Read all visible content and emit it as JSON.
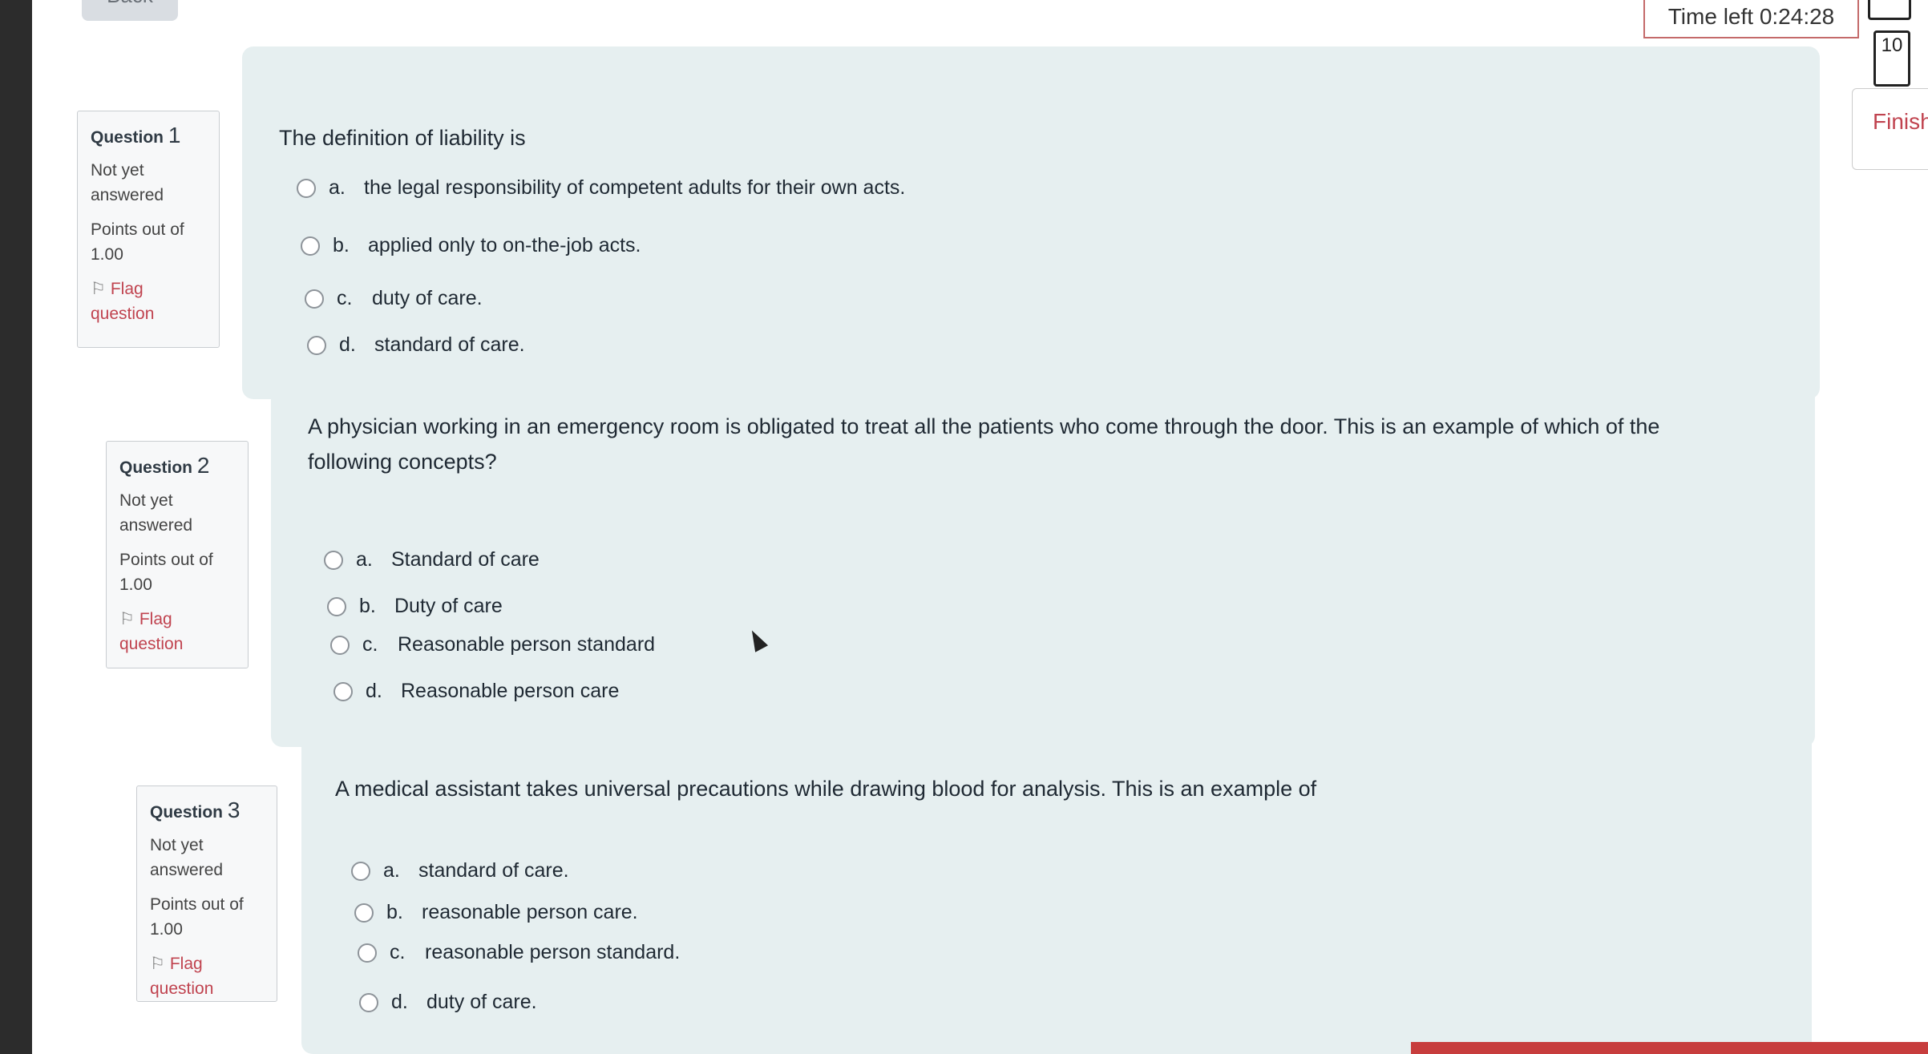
{
  "nav": {
    "back_label": "Back",
    "timer": "Time left 0:24:28",
    "question_box": "10",
    "finish_label": "Finish"
  },
  "questions": [
    {
      "label": "Question",
      "number": "1",
      "state": "Not yet answered",
      "points": "Points out of 1.00",
      "flag": "Flag question",
      "text": "The definition of liability is",
      "options": [
        {
          "letter": "a.",
          "text": "the legal responsibility of competent adults for their own acts."
        },
        {
          "letter": "b.",
          "text": "applied only to on-the-job acts."
        },
        {
          "letter": "c.",
          "text": "duty of care."
        },
        {
          "letter": "d.",
          "text": "standard of care."
        }
      ]
    },
    {
      "label": "Question",
      "number": "2",
      "state": "Not yet answered",
      "points": "Points out of 1.00",
      "flag": "Flag question",
      "text": "A physician working in an emergency room is obligated to treat all the patients who come through the door. This is an example of which of the following concepts?",
      "options": [
        {
          "letter": "a.",
          "text": "Standard of care"
        },
        {
          "letter": "b.",
          "text": "Duty of care"
        },
        {
          "letter": "c.",
          "text": "Reasonable person standard"
        },
        {
          "letter": "d.",
          "text": "Reasonable person care"
        }
      ]
    },
    {
      "label": "Question",
      "number": "3",
      "state": "Not yet answered",
      "points": "Points out of 1.00",
      "flag": "Flag question",
      "text": "A medical assistant takes universal precautions while drawing blood for analysis. This is an example of",
      "options": [
        {
          "letter": "a.",
          "text": "standard of care."
        },
        {
          "letter": "b.",
          "text": "reasonable person care."
        },
        {
          "letter": "c.",
          "text": "reasonable person standard."
        },
        {
          "letter": "d.",
          "text": "duty of care."
        }
      ]
    }
  ],
  "colors": {
    "card_bg": "#e6eff0",
    "flag": "#c0434f",
    "timer_border": "#c46a6a"
  }
}
